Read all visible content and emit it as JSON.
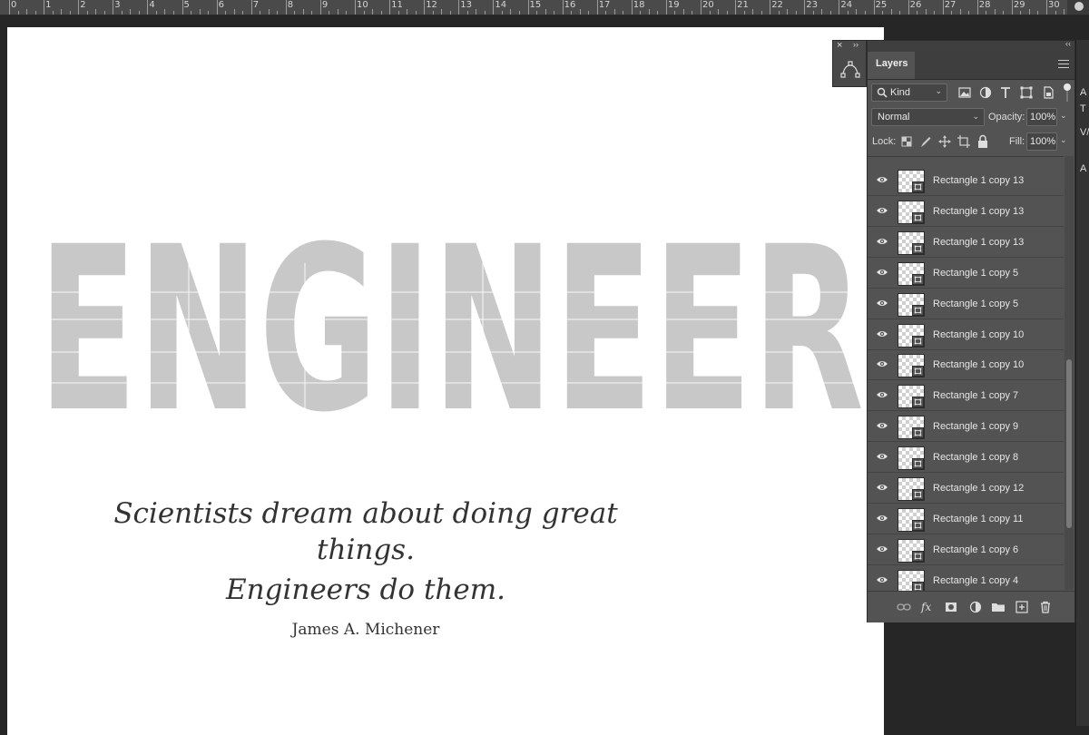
{
  "ruler": {
    "labels": [
      "0",
      "1",
      "2",
      "3",
      "4",
      "5",
      "6",
      "7",
      "8",
      "9",
      "10",
      "11",
      "12",
      "13",
      "14",
      "15",
      "16",
      "17",
      "18",
      "19",
      "20",
      "21",
      "22",
      "23",
      "24",
      "25",
      "26",
      "27",
      "28",
      "29",
      "30"
    ]
  },
  "artboard": {
    "headline": "ENGINEER",
    "quote_line1": "Scientists dream about doing great things.",
    "quote_line2": "Engineers do them.",
    "author": "James A. Michener"
  },
  "side_strip": {
    "snippets": [
      "A",
      "T",
      "V/",
      "A"
    ]
  },
  "path_panel": {
    "close_glyph": "×",
    "expand_glyph": "››"
  },
  "layers_panel": {
    "collapse_glyph": "‹‹",
    "tab_label": "Layers",
    "filter": {
      "kind_label": "Kind"
    },
    "blend_mode": "Normal",
    "opacity_label": "Opacity:",
    "opacity_value": "100%",
    "lock_label": "Lock:",
    "fill_label": "Fill:",
    "fill_value": "100%",
    "layers": [
      {
        "name": "Rectangle 1 copy 13"
      },
      {
        "name": "Rectangle 1 copy 13"
      },
      {
        "name": "Rectangle 1 copy 13"
      },
      {
        "name": "Rectangle 1 copy 5"
      },
      {
        "name": "Rectangle 1 copy 5"
      },
      {
        "name": "Rectangle 1 copy 10"
      },
      {
        "name": "Rectangle 1 copy 10"
      },
      {
        "name": "Rectangle 1 copy 7"
      },
      {
        "name": "Rectangle 1 copy 9"
      },
      {
        "name": "Rectangle 1 copy 8"
      },
      {
        "name": "Rectangle 1 copy 12"
      },
      {
        "name": "Rectangle 1 copy 11"
      },
      {
        "name": "Rectangle 1 copy 6"
      },
      {
        "name": "Rectangle 1 copy 4"
      }
    ]
  },
  "colors": {
    "app_bg": "#262626",
    "panel_bg": "#535353",
    "letter_fill": "#c8c8c8",
    "canvas": "#ffffff"
  }
}
